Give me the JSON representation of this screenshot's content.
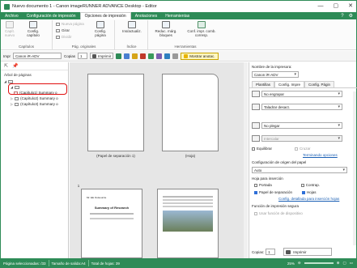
{
  "window": {
    "title": "Nuevo documento 1 - Canon imageRUNNER ADVANCE Desktop - Editor",
    "minimize": "—",
    "maximize": "▢",
    "close": "✕"
  },
  "tabs": [
    {
      "label": "Archivo",
      "active": false
    },
    {
      "label": "Configuración de impresión",
      "active": false
    },
    {
      "label": "Opciones de impresión",
      "active": true
    },
    {
      "label": "Anotaciones",
      "active": false
    },
    {
      "label": "Herramientas",
      "active": false
    }
  ],
  "ribbon": {
    "groups": {
      "chapters": "Capítulos",
      "orig_pages": "Pág. originales",
      "index": "Índice",
      "tools": "Herramientas"
    },
    "buttons": {
      "new_chapter": "Capít. nuevo",
      "chapter_config": "Config. capítulo",
      "new_page": "Nueva página",
      "rotate": "Girar",
      "split": "Dividir",
      "page_config": "Config. página",
      "insert_tab": "Ins/actualiz.",
      "reduce_margins": "Reduc. márg. bloques",
      "combined_print": "Conf. impr. comb. corresp."
    }
  },
  "toolbar": {
    "printer_label": "Impr",
    "printer_value": "Canon iR-ADV",
    "copies_label": "Copias",
    "copies_value": "1",
    "print_label": "Imprimir",
    "show_annotations": "Mostrar anotac."
  },
  "left_panel": {
    "title": "Árbol de páginas",
    "items": [
      {
        "label": "(Capítulo1) Summary o"
      },
      {
        "label": "(Capítulo2) Summary o"
      },
      {
        "label": "(Capítulo3) Summary o"
      }
    ]
  },
  "center": {
    "pages": [
      {
        "caption": "(Papel de separación 1)"
      },
      {
        "caption": "(Hoja)"
      }
    ],
    "row2_number": "1",
    "row2_page_title": "Summary of Research",
    "row2_header": "Mr. EE Outsourcie"
  },
  "right_panel": {
    "printer_label": "Nombre de la impresora:",
    "printer_value": "Canon iR-ADV",
    "tabs": [
      "Plantillas",
      "Config. Impre",
      "Config. Págin"
    ],
    "staple": "No engrapar",
    "punch": "Taladrar desact.",
    "fold": "No plegar",
    "interleave": "Intercalar",
    "face_down": "Equilibrar",
    "face_up": "Cruzar",
    "finishing_link": "Terminando opciones",
    "paper_source_label": "Configuración de origen del papel",
    "paper_source_value": "Auto",
    "sheet_insert_label": "Hoja para inserción",
    "front_cover": "Portada",
    "back_cover": "Contrap.",
    "separator": "Papel de separación",
    "sheets": "Hojas",
    "detail_link": "Config. detallada para inserción hojas",
    "secure_label": "Función de impresión segura",
    "secure_use": "Usar función de dispositivo",
    "copies_label": "Copias:",
    "copies_value": "1",
    "print_button": "Imprimir"
  },
  "status": {
    "selected_pages": "Página seleccionadas: /33",
    "paper_size": "Tamaño de salida:A4",
    "total_sheets": "Total de hojas: 39",
    "zoom": "25%"
  }
}
